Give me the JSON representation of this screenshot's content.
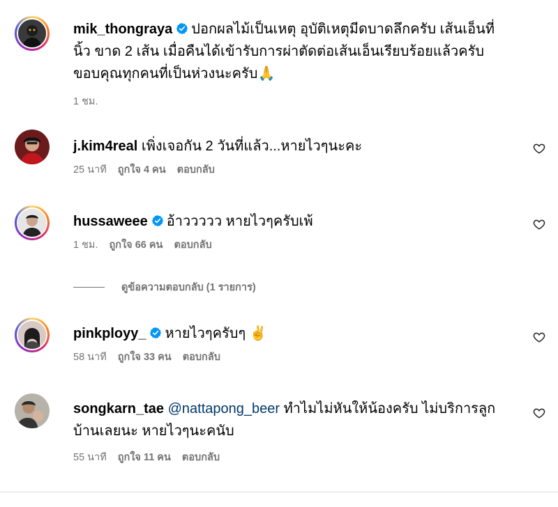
{
  "post": {
    "username": "mik_thongraya",
    "verified": true,
    "caption": "ปอกผลไม้เป็นเหตุ อุบัติเหตุมีดบาดลึกครับ เส้นเอ็นที่นิ้ว ขาด 2 เส้น เมื่อคืนได้เข้ารับการผ่าตัดต่อเส้นเอ็นเรียบร้อยแล้วครับ ขอบคุณทุกคนที่เป็นห่วงนะครับ🙏",
    "time": "1 ชม."
  },
  "comments": [
    {
      "username": "j.kim4real",
      "verified": false,
      "text": "เพิ่งเจอกัน 2 วันที่แล้ว...หายไวๆนะคะ",
      "time": "25 นาที",
      "likes": "ถูกใจ 4 คน",
      "reply": "ตอบกลับ"
    },
    {
      "username": "hussaweee",
      "verified": true,
      "text": "อ้าววววว หายไวๆครับเพ้",
      "time": "1 ชม.",
      "likes": "ถูกใจ 66 คน",
      "reply": "ตอบกลับ"
    },
    {
      "username": "pinkployy_",
      "verified": true,
      "text": "หายไวๆครับๆ ✌️",
      "time": "58 นาที",
      "likes": "ถูกใจ 33 คน",
      "reply": "ตอบกลับ"
    },
    {
      "username": "songkarn_tae",
      "verified": false,
      "mention": "@nattapong_beer",
      "text": "ทำไมไม่หันให้น้องครับ ไม่บริการลูกบ้านเลยนะ หายไวๆนะคนับ",
      "time": "55 นาที",
      "likes": "ถูกใจ 11 คน",
      "reply": "ตอบกลับ"
    }
  ],
  "view_replies": "ดูข้อความตอบกลับ (1 รายการ)",
  "colors": {
    "verified": "#0095f6",
    "secondary": "#737373",
    "mention": "#00376b"
  }
}
